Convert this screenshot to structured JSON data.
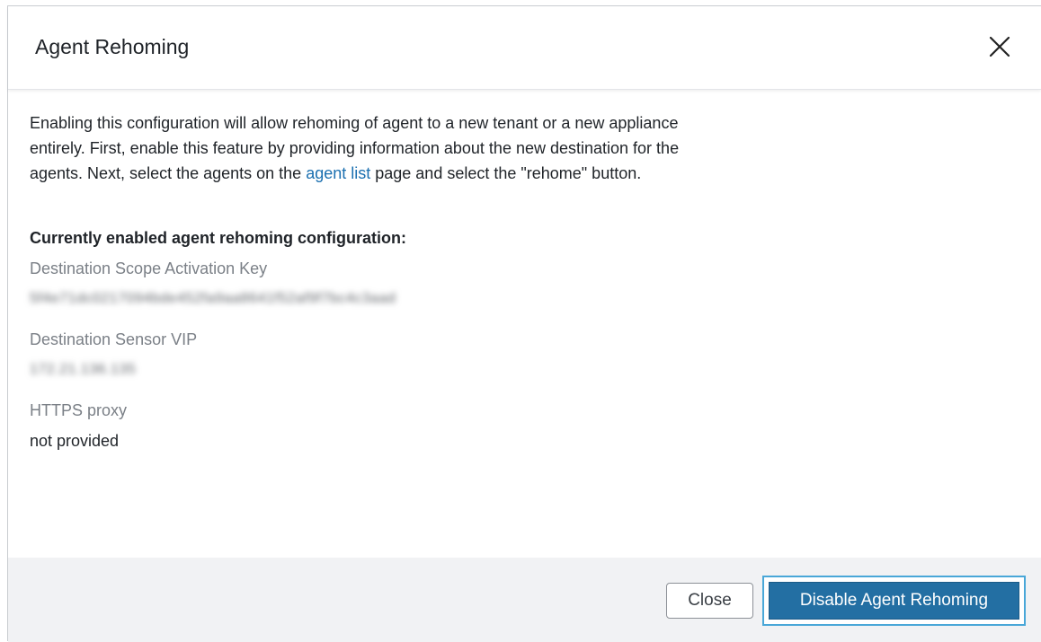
{
  "dialog": {
    "title": "Agent Rehoming",
    "close_icon": "close-icon"
  },
  "body": {
    "intro_before_link": "Enabling this configuration will allow rehoming of agent to a new tenant or a new appliance entirely. First, enable this feature by providing information about the new destination for the agents. Next, select the agents on the ",
    "intro_link": "agent list",
    "intro_after_link": " page and select the \"rehome\" button.",
    "section_heading": "Currently enabled agent rehoming configuration:",
    "fields": [
      {
        "label": "Destination Scope Activation Key",
        "value": "5f4e71dc0217094bde452fa9aa8641f52af9f7bc4c3aad",
        "blurred": true
      },
      {
        "label": "Destination Sensor VIP",
        "value": "172.21.136.135",
        "blurred": true
      },
      {
        "label": "HTTPS proxy",
        "value": "not provided",
        "blurred": false
      }
    ]
  },
  "footer": {
    "close_label": "Close",
    "disable_label": "Disable Agent Rehoming"
  },
  "colors": {
    "link": "#1a6fb0",
    "primary_button": "#236fa3",
    "focus_ring": "#49a7d8",
    "footer_bg": "#f1f2f4"
  }
}
